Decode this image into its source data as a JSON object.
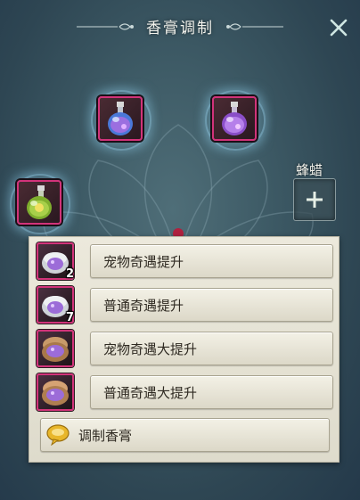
{
  "header": {
    "title": "香膏调制"
  },
  "side_slot": {
    "label": "蜂蜡"
  },
  "recipes": [
    {
      "label": "宠物奇遇提升",
      "count": "2",
      "icon": "pearl-shell-icon"
    },
    {
      "label": "普通奇遇提升",
      "count": "7",
      "icon": "pearl-shell-icon"
    },
    {
      "label": "宠物奇遇大提升",
      "count": "",
      "icon": "cosmetic-compact-icon"
    },
    {
      "label": "普通奇遇大提升",
      "count": "",
      "icon": "cosmetic-compact-icon"
    }
  ],
  "craft_button": {
    "label": "调制香膏",
    "icon": "speech-bubble-icon"
  },
  "slots": [
    {
      "icon": "blue-potion-bottle-icon"
    },
    {
      "icon": "purple-potion-bottle-icon"
    },
    {
      "icon": "green-potion-bottle-icon"
    }
  ],
  "colors": {
    "slot_border": "#d2337a",
    "panel_bg": "#e8e5d8",
    "glow": "#8ccdeb"
  }
}
